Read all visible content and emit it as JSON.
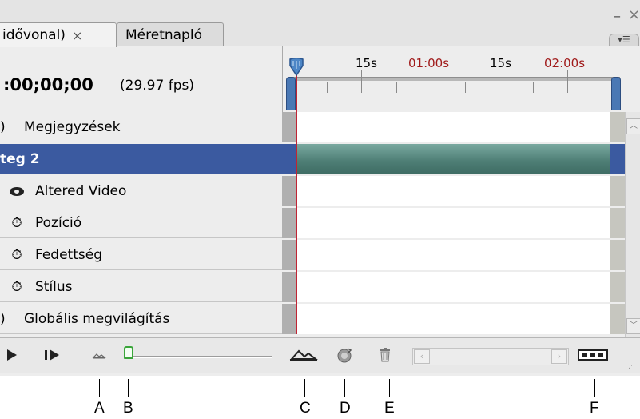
{
  "tabs": [
    {
      "label": "idővonal)",
      "close_symbol": "×"
    },
    {
      "label": "Méretnapló"
    }
  ],
  "window_controls": {
    "minimize": "–",
    "close": "×"
  },
  "panel_menu_icon": "panel-menu-icon",
  "timecode": "00;00;00",
  "timecode_prefix": ":",
  "fps": "(29.97 fps)",
  "ruler": {
    "labels": [
      "15s",
      "01:00s",
      "15s",
      "02:00s"
    ],
    "label_colors": [
      "#000000",
      "#a01a1a",
      "#000000",
      "#a01a1a"
    ]
  },
  "rows": [
    {
      "label": "Megjegyzések",
      "icon": "expand-triangle-icon",
      "selected": false
    },
    {
      "label": "teg 2",
      "icon": "",
      "selected": true
    },
    {
      "label": "Altered Video",
      "icon": "eye-icon",
      "selected": false
    },
    {
      "label": "Pozíció",
      "icon": "stopwatch-icon",
      "selected": false
    },
    {
      "label": "Fedettség",
      "icon": "stopwatch-icon",
      "selected": false
    },
    {
      "label": "Stílus",
      "icon": "stopwatch-icon",
      "selected": false
    },
    {
      "label": "Globális megvilágítás",
      "icon": "expand-triangle-icon",
      "selected": false
    }
  ],
  "callouts": [
    "A",
    "B",
    "C",
    "D",
    "E",
    "F"
  ],
  "colors": {
    "selected_row": "#3b5aa0",
    "clip": "#4f7f76",
    "playhead": "#c02434",
    "zoom_thumb": "#3aa53a"
  }
}
